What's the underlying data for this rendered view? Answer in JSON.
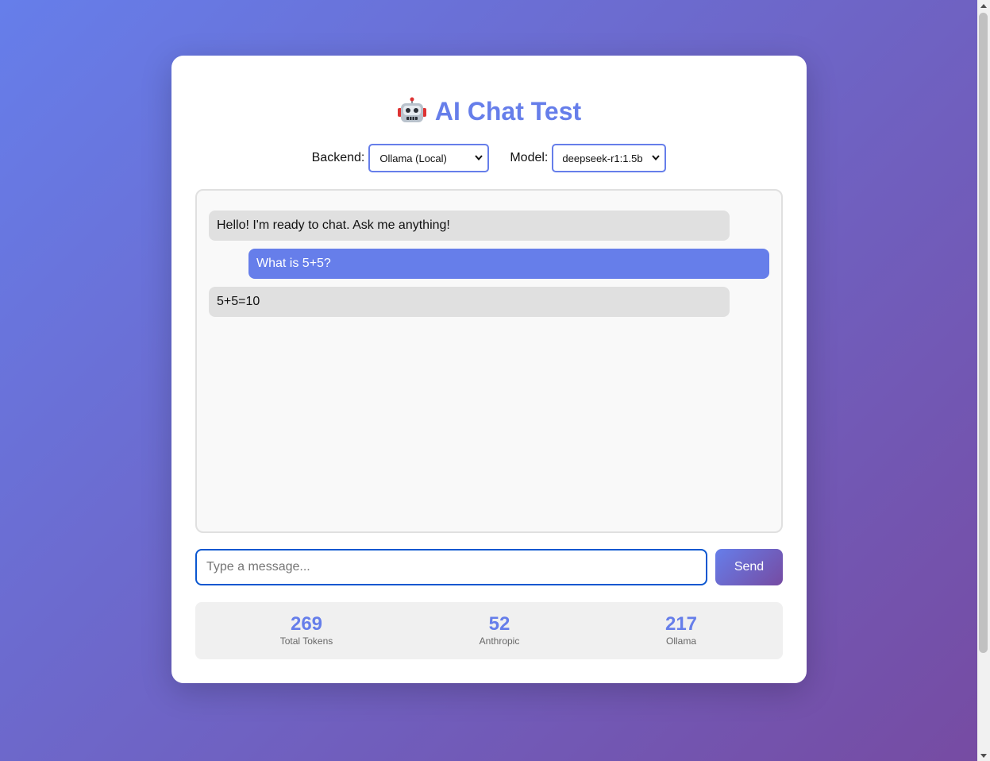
{
  "header": {
    "title": "AI Chat Test",
    "icon": "robot-icon"
  },
  "controls": {
    "backend_label": "Backend:",
    "backend_value": "Ollama (Local)",
    "model_label": "Model:",
    "model_value": "deepseek-r1:1.5b"
  },
  "messages": [
    {
      "role": "bot",
      "text": "Hello! I'm ready to chat. Ask me anything!"
    },
    {
      "role": "user",
      "text": "What is 5+5?"
    },
    {
      "role": "bot",
      "text": "5+5=10"
    }
  ],
  "input": {
    "placeholder": "Type a message...",
    "value": "",
    "send_label": "Send"
  },
  "stats": [
    {
      "value": "269",
      "label": "Total Tokens"
    },
    {
      "value": "52",
      "label": "Anthropic"
    },
    {
      "value": "217",
      "label": "Ollama"
    }
  ],
  "colors": {
    "accent": "#667eea",
    "gradient_end": "#764ba2",
    "bot_bubble": "#e0e0e0",
    "user_bubble": "#667eea"
  }
}
